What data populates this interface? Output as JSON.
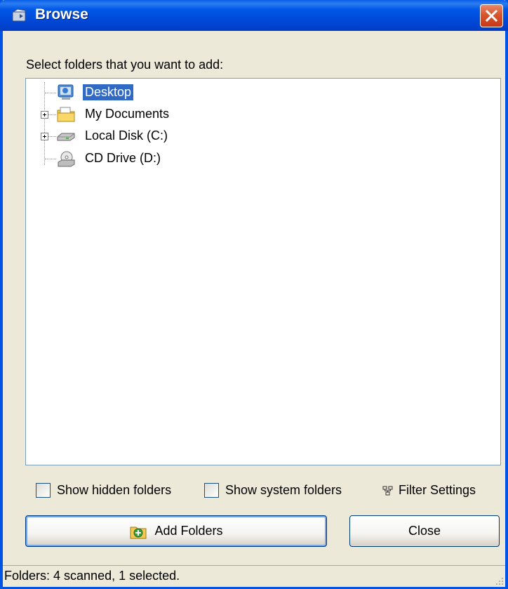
{
  "window": {
    "title": "Browse"
  },
  "prompt": "Select folders that you want to add:",
  "tree": {
    "items": [
      {
        "label": "Desktop",
        "icon": "desktop-icon",
        "selected": true
      },
      {
        "label": "My Documents",
        "icon": "my-documents-icon",
        "expandable": true
      },
      {
        "label": "Local Disk (C:)",
        "icon": "hard-disk-icon",
        "expandable": true
      },
      {
        "label": "CD Drive (D:)",
        "icon": "cd-drive-icon"
      }
    ]
  },
  "options": {
    "show_hidden": "Show hidden folders",
    "show_system": "Show system folders",
    "filter_settings": "Filter Settings"
  },
  "buttons": {
    "add_folders": "Add Folders",
    "close": "Close"
  },
  "status": "Folders: 4 scanned, 1 selected.",
  "colors": {
    "title_bar": "#0054e3",
    "selection": "#316ac5",
    "close_button": "#d9542c"
  }
}
